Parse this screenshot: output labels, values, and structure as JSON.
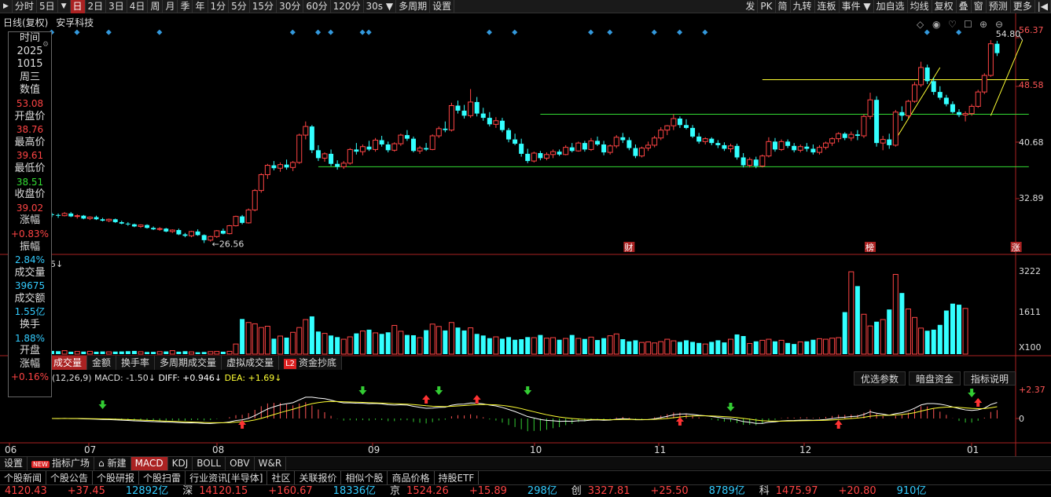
{
  "toolbar": {
    "items": [
      {
        "label": "分时",
        "active": false
      },
      {
        "label": "5日",
        "active": false
      },
      {
        "label": "▼",
        "active": false,
        "arrow": true
      },
      {
        "label": "日",
        "active": true
      },
      {
        "label": "2日",
        "active": false
      },
      {
        "label": "3日",
        "active": false
      },
      {
        "label": "4日",
        "active": false
      },
      {
        "label": "周",
        "active": false
      },
      {
        "label": "月",
        "active": false
      },
      {
        "label": "季",
        "active": false
      },
      {
        "label": "年",
        "active": false
      },
      {
        "label": "1分",
        "active": false
      },
      {
        "label": "5分",
        "active": false
      },
      {
        "label": "15分",
        "active": false
      },
      {
        "label": "30分",
        "active": false
      },
      {
        "label": "60分",
        "active": false
      },
      {
        "label": "120分",
        "active": false
      },
      {
        "label": "30s  ▼",
        "active": false
      },
      {
        "label": "多周期",
        "active": false
      },
      {
        "label": "设置",
        "active": false
      }
    ],
    "right_items": [
      "发",
      "PK",
      "简",
      "九转",
      "连板",
      "事件 ▼",
      "加自选",
      "均线",
      "复权",
      "叠",
      "窗",
      "预测",
      "更多",
      "|◀"
    ]
  },
  "title": {
    "mode": "日线(复权)",
    "name": "安孚科技"
  },
  "info_panel": [
    {
      "k": "时间",
      "v": null
    },
    {
      "k": "2025",
      "v": null
    },
    {
      "k": "1015",
      "v": null
    },
    {
      "k": "周三",
      "v": null
    },
    {
      "k": "数值",
      "v": "53.08",
      "c": "red"
    },
    {
      "k": "开盘价",
      "v": "38.76",
      "c": "red"
    },
    {
      "k": "最高价",
      "v": "39.61",
      "c": "red"
    },
    {
      "k": "最低价",
      "v": "38.51",
      "c": "green"
    },
    {
      "k": "收盘价",
      "v": "39.02",
      "c": "red"
    },
    {
      "k": "涨幅",
      "v": "+0.83%",
      "c": "red"
    },
    {
      "k": "振幅",
      "v": "2.84%",
      "c": "cyan"
    },
    {
      "k": "成交量",
      "v": "39675",
      "c": "cyan"
    },
    {
      "k": "成交额",
      "v": "1.55亿",
      "c": "cyan"
    },
    {
      "k": "换手",
      "v": "1.88%",
      "c": "cyan"
    },
    {
      "k": "开盘",
      "v": null
    },
    {
      "k": "涨幅",
      "v": "+0.16%",
      "c": "red"
    }
  ],
  "price_axis": [
    "56.37",
    "48.58",
    "40.68",
    "32.89"
  ],
  "price_annotations": {
    "high": "54.80",
    "low": "26.56"
  },
  "markers": {
    "cai": "财",
    "bang": "榜",
    "zhang": "涨"
  },
  "vol_axis": [
    "3222",
    "1611",
    "X100"
  ],
  "vol_tabs": [
    "成交量",
    "金额",
    "换手率",
    "多周期成交量",
    "虚拟成交量",
    "资金抄底"
  ],
  "macd_header": {
    "params": "(12,26,9)",
    "macd": "MACD: -1.50↓",
    "diff": "DIFF: +0.946↓",
    "dea": "DEA: +1.69↓"
  },
  "macd_axis": [
    "+2.37",
    "0"
  ],
  "macd_buttons": [
    "优选参数",
    "暗盘资金",
    "指标说明"
  ],
  "months": [
    "06",
    "07",
    "08",
    "09",
    "10",
    "11",
    "12",
    "01"
  ],
  "indicator_tabs": [
    "设置",
    "指标广场",
    "新建",
    "MACD",
    "KDJ",
    "BOLL",
    "OBV",
    "W&R"
  ],
  "news_tabs": [
    "个股新闻",
    "个股公告",
    "个股研报",
    "个股扫雷",
    "行业资讯[半导体]",
    "社区",
    "关联报价",
    "相似个股",
    "商品价格",
    "持股ETF"
  ],
  "ticker": [
    {
      "name": "",
      "value": "4120.43",
      "change": "+37.45",
      "amount": "12892亿"
    },
    {
      "name": "深",
      "value": "14120.15",
      "change": "+160.67",
      "amount": "18336亿"
    },
    {
      "name": "京",
      "value": "1524.26",
      "change": "+15.89",
      "amount": "298亿"
    },
    {
      "name": "创",
      "value": "3327.81",
      "change": "+25.50",
      "amount": "8789亿"
    },
    {
      "name": "科",
      "value": "1475.97",
      "change": "+20.80",
      "amount": "910亿"
    }
  ],
  "chart_data": {
    "type": "candlestick",
    "price_range": [
      26.0,
      57.0
    ],
    "candles": [
      [
        30.6,
        30.8,
        30.2,
        30.5
      ],
      [
        30.5,
        30.7,
        30.1,
        30.4
      ],
      [
        30.4,
        30.9,
        30.3,
        30.7
      ],
      [
        30.7,
        30.9,
        30.2,
        30.3
      ],
      [
        30.3,
        30.6,
        30.0,
        30.4
      ],
      [
        30.4,
        30.5,
        29.9,
        30.0
      ],
      [
        30.0,
        30.3,
        29.8,
        30.2
      ],
      [
        30.2,
        30.4,
        29.8,
        29.9
      ],
      [
        29.9,
        30.1,
        29.6,
        29.7
      ],
      [
        29.7,
        30.0,
        29.5,
        29.9
      ],
      [
        29.9,
        30.0,
        29.4,
        29.5
      ],
      [
        29.5,
        29.7,
        29.2,
        29.3
      ],
      [
        29.3,
        29.5,
        29.0,
        29.2
      ],
      [
        29.2,
        29.3,
        28.8,
        28.9
      ],
      [
        28.9,
        29.2,
        28.7,
        29.1
      ],
      [
        29.1,
        29.2,
        28.6,
        28.7
      ],
      [
        28.7,
        28.9,
        28.4,
        28.5
      ],
      [
        28.5,
        28.8,
        28.3,
        28.6
      ],
      [
        28.6,
        28.7,
        28.1,
        28.2
      ],
      [
        28.2,
        28.5,
        28.0,
        28.4
      ],
      [
        28.4,
        28.6,
        27.7,
        27.8
      ],
      [
        27.8,
        28.0,
        27.4,
        27.6
      ],
      [
        27.6,
        28.3,
        27.4,
        28.2
      ],
      [
        28.2,
        28.5,
        27.6,
        27.7
      ],
      [
        27.7,
        27.8,
        26.6,
        27.0
      ],
      [
        27.0,
        27.6,
        26.8,
        27.5
      ],
      [
        27.5,
        28.4,
        27.3,
        28.3
      ],
      [
        28.3,
        28.6,
        27.8,
        27.9
      ],
      [
        27.9,
        29.1,
        27.8,
        29.0
      ],
      [
        29.0,
        30.4,
        28.9,
        30.3
      ],
      [
        30.3,
        30.5,
        29.2,
        29.4
      ],
      [
        29.4,
        31.4,
        29.3,
        31.2
      ],
      [
        31.2,
        34.1,
        31.0,
        33.9
      ],
      [
        33.9,
        36.3,
        33.6,
        36.1
      ],
      [
        36.1,
        37.6,
        35.5,
        37.4
      ],
      [
        37.4,
        38.0,
        36.7,
        37.0
      ],
      [
        37.0,
        37.8,
        36.5,
        37.5
      ],
      [
        37.5,
        38.2,
        36.8,
        37.1
      ],
      [
        37.1,
        38.0,
        36.6,
        37.8
      ],
      [
        37.8,
        41.8,
        37.6,
        41.6
      ],
      [
        41.6,
        43.5,
        41.0,
        42.8
      ],
      [
        42.8,
        43.0,
        39.1,
        39.5
      ],
      [
        39.5,
        40.2,
        38.0,
        38.4
      ],
      [
        38.4,
        39.2,
        37.9,
        39.0
      ],
      [
        39.0,
        39.6,
        37.3,
        37.6
      ],
      [
        37.6,
        38.1,
        36.8,
        37.2
      ],
      [
        37.2,
        38.0,
        36.9,
        37.7
      ],
      [
        37.7,
        39.8,
        37.5,
        39.6
      ],
      [
        39.6,
        40.5,
        38.9,
        39.3
      ],
      [
        39.3,
        40.3,
        38.8,
        40.0
      ],
      [
        40.0,
        40.8,
        39.4,
        39.6
      ],
      [
        39.6,
        41.2,
        39.3,
        40.9
      ],
      [
        40.9,
        41.5,
        40.0,
        40.3
      ],
      [
        40.3,
        40.7,
        39.2,
        39.5
      ],
      [
        39.5,
        40.6,
        39.3,
        40.4
      ],
      [
        40.4,
        41.8,
        40.1,
        41.6
      ],
      [
        41.6,
        42.3,
        40.8,
        41.1
      ],
      [
        41.1,
        41.4,
        39.2,
        39.4
      ],
      [
        39.4,
        40.1,
        39.0,
        39.8
      ],
      [
        39.8,
        40.5,
        39.4,
        39.6
      ],
      [
        39.6,
        41.7,
        39.5,
        41.5
      ],
      [
        41.5,
        42.8,
        41.2,
        42.5
      ],
      [
        42.5,
        43.5,
        42.0,
        42.3
      ],
      [
        42.3,
        46.1,
        42.1,
        45.7
      ],
      [
        45.7,
        46.4,
        44.6,
        45.0
      ],
      [
        45.0,
        45.8,
        43.9,
        44.3
      ],
      [
        44.3,
        48.0,
        44.0,
        46.2
      ],
      [
        46.2,
        46.9,
        44.2,
        44.6
      ],
      [
        44.6,
        45.4,
        43.6,
        44.0
      ],
      [
        44.0,
        44.8,
        42.8,
        43.1
      ],
      [
        43.1,
        44.1,
        42.6,
        43.6
      ],
      [
        43.6,
        44.0,
        42.0,
        42.3
      ],
      [
        42.3,
        42.6,
        40.6,
        41.0
      ],
      [
        41.0,
        41.8,
        40.2,
        40.4
      ],
      [
        40.4,
        41.1,
        38.6,
        39.0
      ],
      [
        39.0,
        39.7,
        37.7,
        38.0
      ],
      [
        38.0,
        39.3,
        37.8,
        39.1
      ],
      [
        39.1,
        39.4,
        38.1,
        38.4
      ],
      [
        38.4,
        39.2,
        38.1,
        38.9
      ],
      [
        38.9,
        39.6,
        38.4,
        39.3
      ],
      [
        39.3,
        39.6,
        38.7,
        38.9
      ],
      [
        38.9,
        40.2,
        38.8,
        39.9
      ],
      [
        39.9,
        40.5,
        39.2,
        39.4
      ],
      [
        39.4,
        40.7,
        39.3,
        40.5
      ],
      [
        40.5,
        40.8,
        39.3,
        39.6
      ],
      [
        39.6,
        41.2,
        39.4,
        40.8
      ],
      [
        40.8,
        41.4,
        40.1,
        40.3
      ],
      [
        40.3,
        40.8,
        38.8,
        39.2
      ],
      [
        39.2,
        40.3,
        38.9,
        40.1
      ],
      [
        40.1,
        41.6,
        39.8,
        41.3
      ],
      [
        41.3,
        41.9,
        40.5,
        40.9
      ],
      [
        40.9,
        41.3,
        39.5,
        39.8
      ],
      [
        39.8,
        40.3,
        38.4,
        38.7
      ],
      [
        38.7,
        40.0,
        38.5,
        39.8
      ],
      [
        39.8,
        40.7,
        39.4,
        40.2
      ],
      [
        40.2,
        41.5,
        39.9,
        41.2
      ],
      [
        41.2,
        42.7,
        40.9,
        42.3
      ],
      [
        42.3,
        43.0,
        41.6,
        42.9
      ],
      [
        42.9,
        44.5,
        42.3,
        43.9
      ],
      [
        43.9,
        44.2,
        42.6,
        43.0
      ],
      [
        43.0,
        43.8,
        42.4,
        42.6
      ],
      [
        42.6,
        43.0,
        41.2,
        41.4
      ],
      [
        41.4,
        41.9,
        40.4,
        40.7
      ],
      [
        40.7,
        41.3,
        40.3,
        41.1
      ],
      [
        41.1,
        41.3,
        40.2,
        40.5
      ],
      [
        40.5,
        40.9,
        39.8,
        40.2
      ],
      [
        40.2,
        40.6,
        39.4,
        39.7
      ],
      [
        39.7,
        40.4,
        39.2,
        40.1
      ],
      [
        40.1,
        40.4,
        38.2,
        38.5
      ],
      [
        38.5,
        39.1,
        37.1,
        37.4
      ],
      [
        37.4,
        38.5,
        37.1,
        38.2
      ],
      [
        38.2,
        38.6,
        37.0,
        37.3
      ],
      [
        37.3,
        38.9,
        37.1,
        38.7
      ],
      [
        38.7,
        41.3,
        38.5,
        40.7
      ],
      [
        40.7,
        41.2,
        39.3,
        39.6
      ],
      [
        39.6,
        41.0,
        39.4,
        40.7
      ],
      [
        40.7,
        41.0,
        39.8,
        40.1
      ],
      [
        40.1,
        40.5,
        39.2,
        39.5
      ],
      [
        39.5,
        40.3,
        39.2,
        40.0
      ],
      [
        40.0,
        40.5,
        39.3,
        39.7
      ],
      [
        39.7,
        40.3,
        38.9,
        39.2
      ],
      [
        39.2,
        40.2,
        38.9,
        39.9
      ],
      [
        39.9,
        40.7,
        39.6,
        40.5
      ],
      [
        40.5,
        41.3,
        40.1,
        41.1
      ],
      [
        41.1,
        42.0,
        40.6,
        41.8
      ],
      [
        41.8,
        42.0,
        40.9,
        41.2
      ],
      [
        41.2,
        42.1,
        40.8,
        41.7
      ],
      [
        41.7,
        42.3,
        40.9,
        41.5
      ],
      [
        41.5,
        44.5,
        41.2,
        44.2
      ],
      [
        44.2,
        47.5,
        43.8,
        46.5
      ],
      [
        46.5,
        47.0,
        40.0,
        40.5
      ],
      [
        40.5,
        41.5,
        39.5,
        41.0
      ],
      [
        41.0,
        41.8,
        39.7,
        40.2
      ],
      [
        40.2,
        45.1,
        40.0,
        44.8
      ],
      [
        44.8,
        45.6,
        43.6,
        44.3
      ],
      [
        44.3,
        46.5,
        44.0,
        46.3
      ],
      [
        46.3,
        49.0,
        46.1,
        48.6
      ],
      [
        48.6,
        51.8,
        48.3,
        51.0
      ],
      [
        51.0,
        51.4,
        48.7,
        49.1
      ],
      [
        49.1,
        49.6,
        47.2,
        47.6
      ],
      [
        47.6,
        48.4,
        46.5,
        46.8
      ],
      [
        46.8,
        47.2,
        45.6,
        45.9
      ],
      [
        45.9,
        46.3,
        44.6,
        44.8
      ],
      [
        44.8,
        45.2,
        44.1,
        44.4
      ],
      [
        44.4,
        44.9,
        43.5,
        44.6
      ],
      [
        44.6,
        45.9,
        44.3,
        45.6
      ],
      [
        45.6,
        47.9,
        45.4,
        47.6
      ],
      [
        47.6,
        50.2,
        47.3,
        49.9
      ],
      [
        49.9,
        54.8,
        49.7,
        54.3
      ],
      [
        54.3,
        54.7,
        52.6,
        53.0
      ]
    ],
    "volume_range": [
      0,
      3222
    ],
    "volume": [
      120,
      110,
      130,
      90,
      100,
      95,
      105,
      90,
      100,
      85,
      95,
      100,
      110,
      120,
      90,
      80,
      85,
      95,
      100,
      130,
      90,
      110,
      85,
      70,
      80,
      95,
      100,
      90,
      105,
      380,
      1320,
      1190,
      1140,
      1000,
      1050,
      580,
      680,
      620,
      820,
      1000,
      1300,
      1420,
      850,
      780,
      700,
      640,
      560,
      650,
      780,
      870,
      920,
      800,
      760,
      820,
      1080,
      860,
      720,
      710,
      620,
      900,
      1130,
      1040,
      890,
      1190,
      1000,
      890,
      990,
      760,
      700,
      600,
      650,
      580,
      640,
      540,
      560,
      640,
      620,
      720,
      600,
      620,
      540,
      590,
      720,
      590,
      570,
      640,
      530,
      600,
      690,
      760,
      560,
      480,
      520,
      440,
      460,
      420,
      470,
      560,
      500,
      460,
      520,
      460,
      420,
      380,
      460,
      520,
      440,
      560,
      740,
      680,
      400,
      480,
      520,
      560,
      480,
      520,
      420,
      380,
      460,
      480,
      540,
      580,
      560,
      600,
      620,
      1580,
      3100,
      2560,
      1500,
      1060,
      1220,
      1300,
      1680,
      3000,
      2300,
      1700,
      1380,
      980,
      880,
      920,
      1100,
      1640,
      1900,
      1860,
      1720
    ],
    "ma_lines": [
      {
        "color": "#ffff33",
        "from": 112,
        "to": 154,
        "level": 49.3
      },
      {
        "color": "#33dd33",
        "from": 77,
        "to": 154,
        "level": 44.5
      },
      {
        "color": "#33dd33",
        "from": 42,
        "to": 154,
        "level": 37.2
      }
    ],
    "macd_range": [
      -2.8,
      3.0
    ]
  }
}
